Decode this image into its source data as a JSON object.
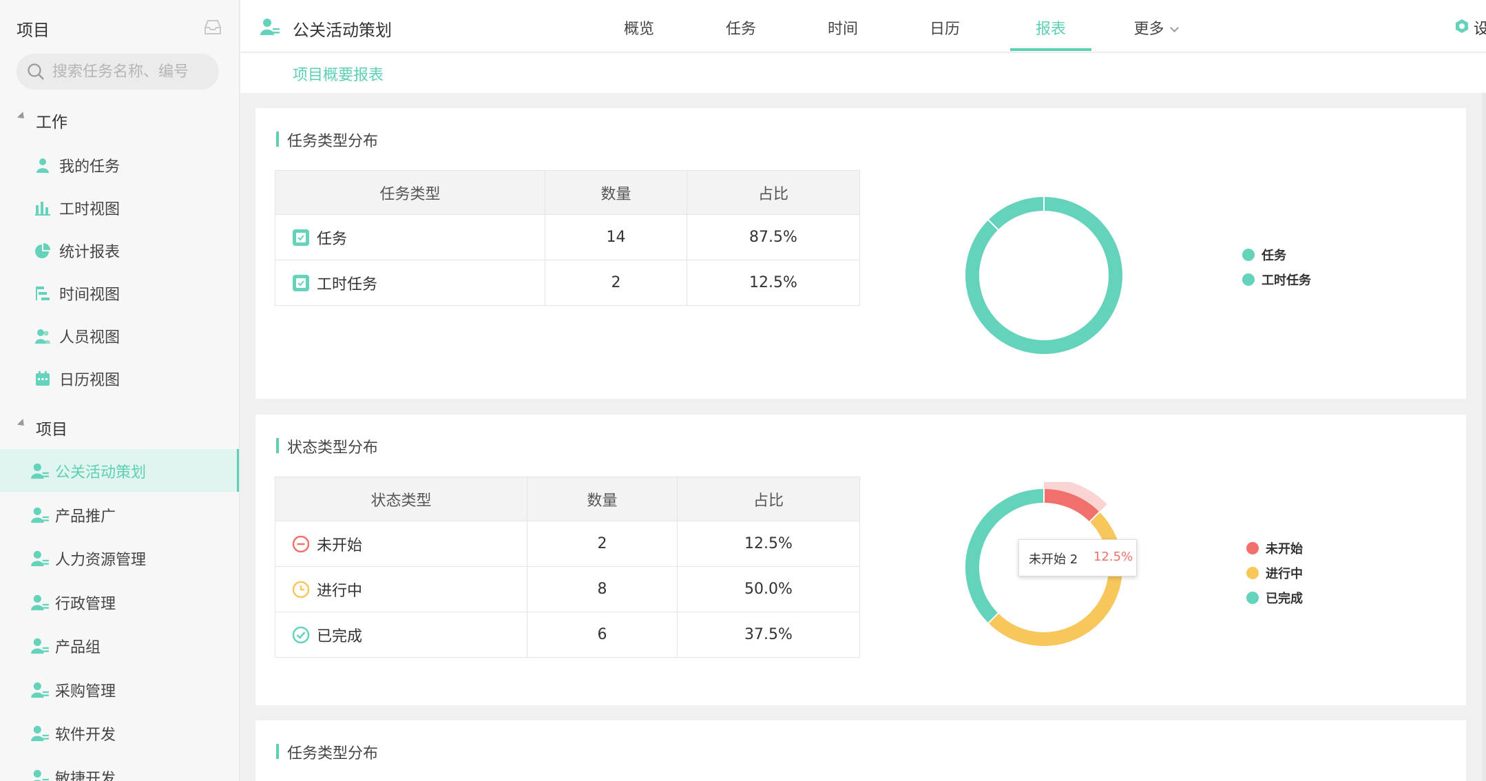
{
  "sidebar": {
    "title": "项目",
    "search_placeholder": "搜索任务名称、编号",
    "work_group": "工作",
    "work_items": [
      {
        "label": "我的任务",
        "icon": "person-icon"
      },
      {
        "label": "工时视图",
        "icon": "bar-chart-icon"
      },
      {
        "label": "统计报表",
        "icon": "pie-chart-icon"
      },
      {
        "label": "时间视图",
        "icon": "gantt-icon"
      },
      {
        "label": "人员视图",
        "icon": "people-icon"
      },
      {
        "label": "日历视图",
        "icon": "calendar-icon"
      }
    ],
    "project_group": "项目",
    "project_items": [
      {
        "label": "公关活动策划",
        "active": true
      },
      {
        "label": "产品推广"
      },
      {
        "label": "人力资源管理"
      },
      {
        "label": "行政管理"
      },
      {
        "label": "产品组"
      },
      {
        "label": "采购管理"
      },
      {
        "label": "软件开发"
      },
      {
        "label": "敏捷开发"
      }
    ]
  },
  "topbar": {
    "project_title": "公关活动策划",
    "tabs": [
      "概览",
      "任务",
      "时间",
      "日历",
      "报表",
      "更多"
    ],
    "active_tab": "报表",
    "settings_label": "设置"
  },
  "subnav": {
    "label": "项目概要报表"
  },
  "panels": [
    {
      "title": "任务类型分布",
      "headers": [
        "任务类型",
        "数量",
        "占比"
      ],
      "rows": [
        {
          "name": "任务",
          "count": "14",
          "ratio": "87.5%"
        },
        {
          "name": "工时任务",
          "count": "2",
          "ratio": "12.5%"
        }
      ]
    },
    {
      "title": "状态类型分布",
      "headers": [
        "状态类型",
        "数量",
        "占比"
      ],
      "rows": [
        {
          "name": "未开始",
          "count": "2",
          "ratio": "12.5%"
        },
        {
          "name": "进行中",
          "count": "8",
          "ratio": "50.0%"
        },
        {
          "name": "已完成",
          "count": "6",
          "ratio": "37.5%"
        }
      ]
    },
    {
      "title": "任务类型分布"
    }
  ],
  "chart_data": [
    {
      "type": "pie",
      "variant": "donut",
      "categories": [
        "任务",
        "工时任务"
      ],
      "values": [
        14,
        2
      ],
      "colors": [
        "#65d3bb",
        "#65d3bb"
      ],
      "legend_position": "right"
    },
    {
      "type": "pie",
      "variant": "donut",
      "categories": [
        "未开始",
        "进行中",
        "已完成"
      ],
      "values": [
        2,
        8,
        6
      ],
      "colors": [
        "#f0716b",
        "#f7c75c",
        "#65d3bb"
      ],
      "legend_position": "right",
      "highlighted": "未开始",
      "tooltip": {
        "label": "未开始 2",
        "percent": "12.5%"
      }
    }
  ],
  "colors": {
    "accent": "#5dcfb4",
    "red": "#f0716b",
    "yellow": "#f7c75c",
    "green": "#65d3bb"
  }
}
